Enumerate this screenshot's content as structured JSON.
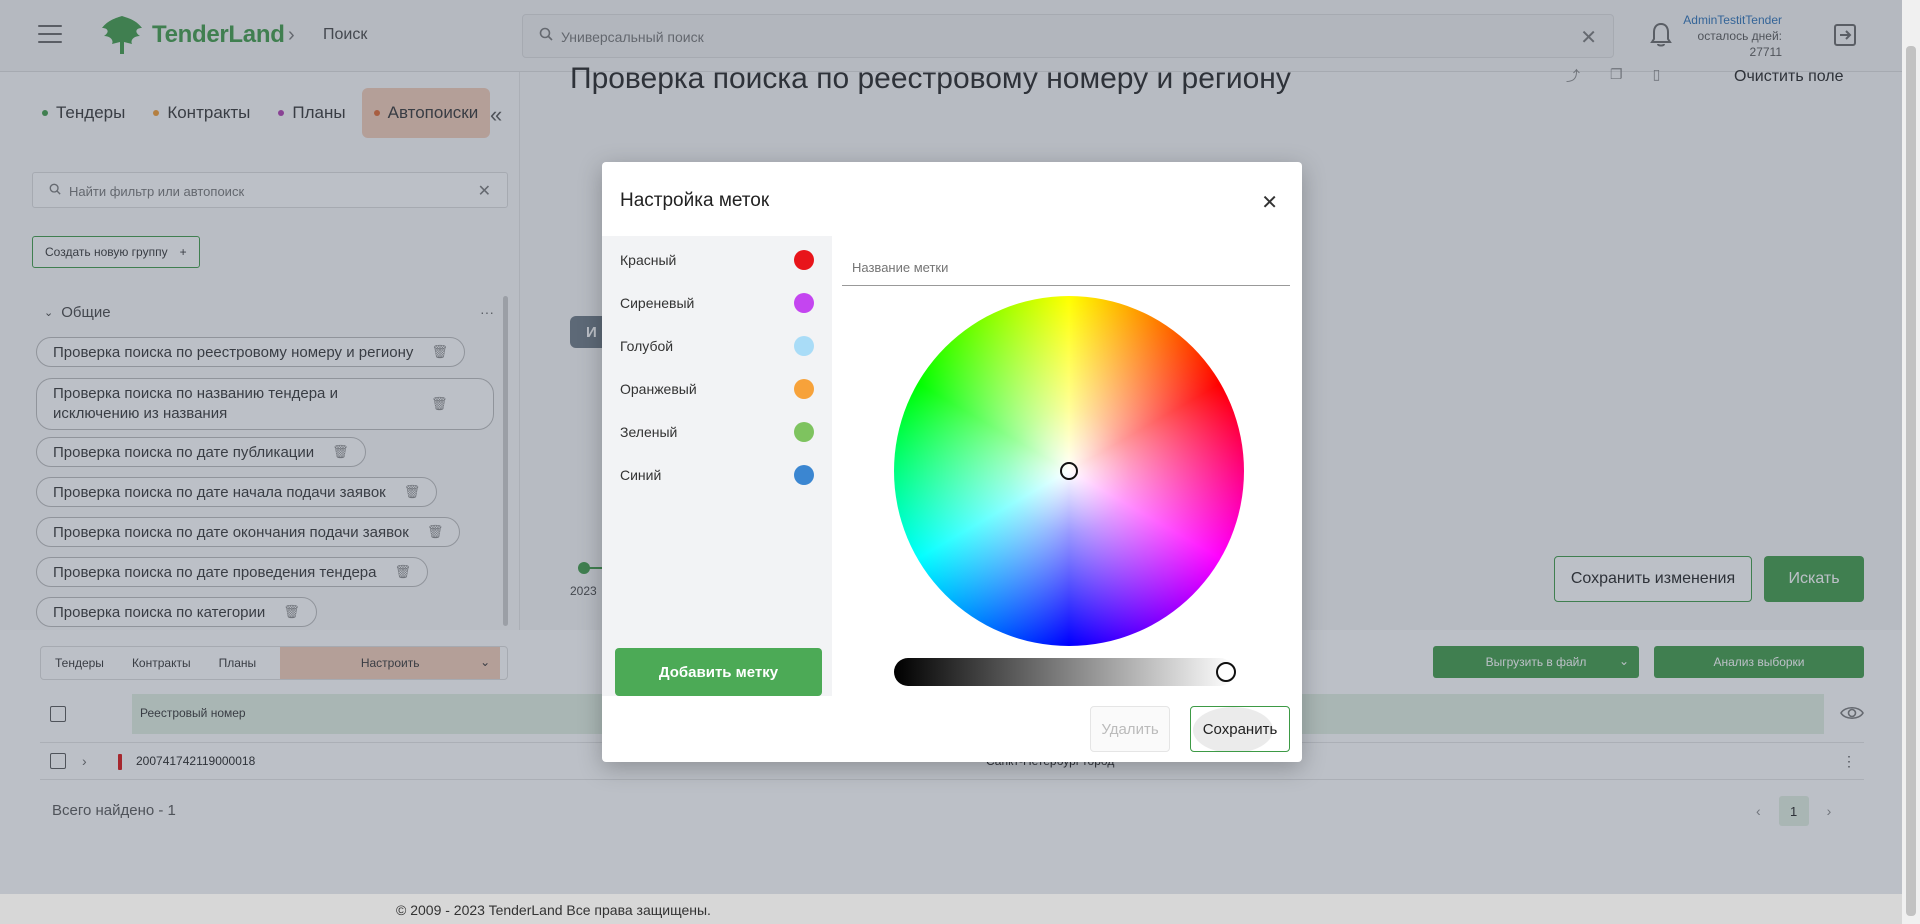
{
  "header": {
    "logo": "TenderLand",
    "breadcrumb": "Поиск",
    "search_placeholder": "Универсальный поиск",
    "user_name": "AdminTestitTender",
    "days_label": "осталось дней:",
    "days_value": "27711"
  },
  "left": {
    "tabs": [
      {
        "label": "Тендеры",
        "color": "#3d9a45"
      },
      {
        "label": "Контракты",
        "color": "#f29a2e"
      },
      {
        "label": "Планы",
        "color": "#b03ab0"
      },
      {
        "label": "Автопоиски",
        "color": "#e0662e",
        "active": true
      }
    ],
    "filter_placeholder": "Найти фильтр или автопоиск",
    "new_group_label": "Создать новую группу",
    "group_title": "Общие",
    "saved_searches": [
      "Проверка поиска по реестровому номеру и региону",
      "Проверка поиска по названию тендера и исключению из названия",
      "Проверка поиска по дате публикации",
      "Проверка поиска по дате начала подачи заявок",
      "Проверка поиска по дате окончания подачи заявок",
      "Проверка поиска по дате проведения тендера",
      "Проверка поиска по категории"
    ]
  },
  "main": {
    "title": "Проверка поиска по реестровому номеру и региону",
    "clear_label": "Очистить поле",
    "chip_letter": "И",
    "year": "2023",
    "save_changes_label": "Сохранить изменения",
    "search_label": "Искать"
  },
  "results": {
    "tabs": [
      "Тендеры",
      "Контракты",
      "Планы"
    ],
    "configure_label": "Настроить",
    "export_label": "Выгрузить в файл",
    "analyze_label": "Анализ выборки",
    "column_header": "Реестровый номер",
    "rows": [
      {
        "number": "200741742119000018",
        "region": "Санкт-Петербург город",
        "mark_color": "#dd1111"
      }
    ],
    "total_label": "Всего найдено - 1",
    "current_page": "1"
  },
  "footer": {
    "copyright": "© 2009 - 2023 TenderLand Все права защищены."
  },
  "modal": {
    "title": "Настройка меток",
    "labels": [
      {
        "name": "Красный",
        "color": "#e8141a"
      },
      {
        "name": "Сиреневый",
        "color": "#c445f0"
      },
      {
        "name": "Голубой",
        "color": "#a9dcf7"
      },
      {
        "name": "Оранжевый",
        "color": "#f7a23a"
      },
      {
        "name": "Зеленый",
        "color": "#7ec35f"
      },
      {
        "name": "Синий",
        "color": "#3b86d1"
      }
    ],
    "name_placeholder": "Название метки",
    "add_label": "Добавить метку",
    "delete_label": "Удалить",
    "save_label": "Сохранить"
  }
}
